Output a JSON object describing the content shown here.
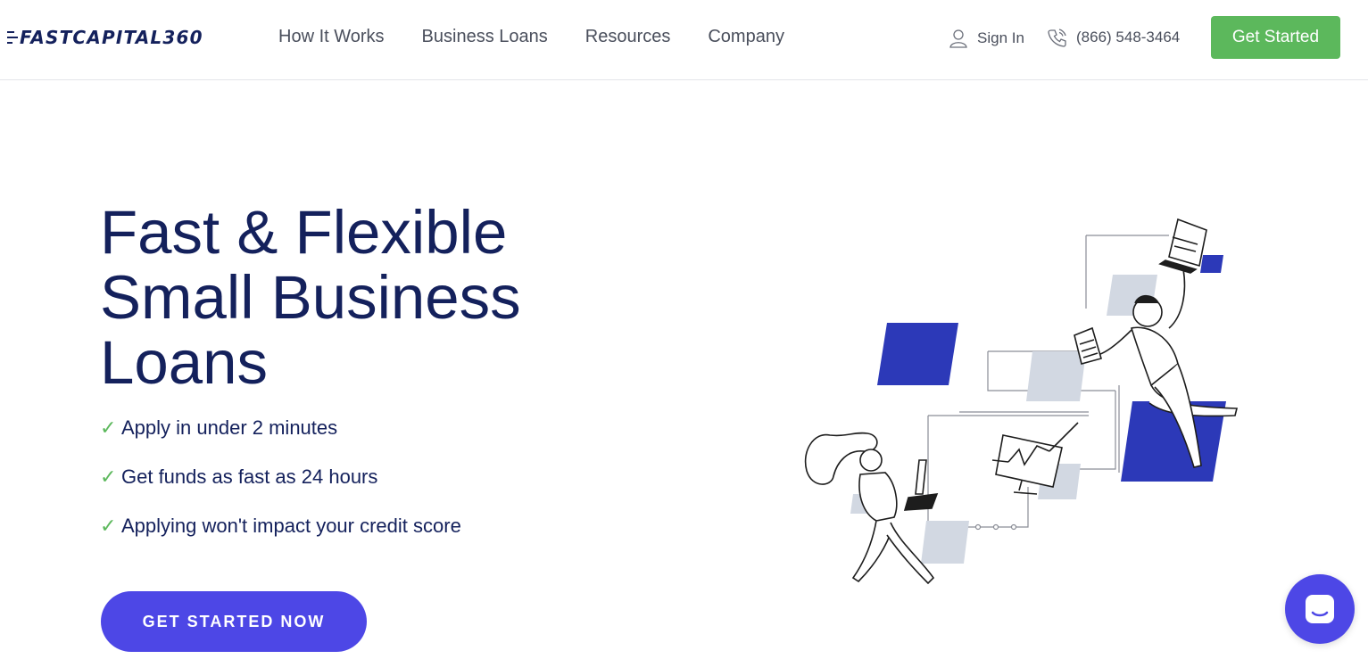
{
  "header": {
    "logo_text": "FASTCAPITAL360",
    "nav": [
      "How It Works",
      "Business Loans",
      "Resources",
      "Company"
    ],
    "sign_in_label": "Sign In",
    "phone_label": "(866) 548-3464",
    "get_started_label": "Get Started"
  },
  "hero": {
    "title": "Fast & Flexible Small Business Loans",
    "benefits": [
      "Apply in under 2 minutes",
      "Get funds as fast as 24 hours",
      "Applying won't impact your credit score"
    ],
    "cta_label": "GET STARTED NOW"
  },
  "icons": {
    "check": "check-icon",
    "user": "user-icon",
    "phone": "phone-icon",
    "chat": "chat-icon"
  },
  "colors": {
    "brand_navy": "#14215c",
    "accent_green": "#5cb85c",
    "accent_blue": "#4d47e6",
    "illustration_blue": "#2c39b8"
  }
}
